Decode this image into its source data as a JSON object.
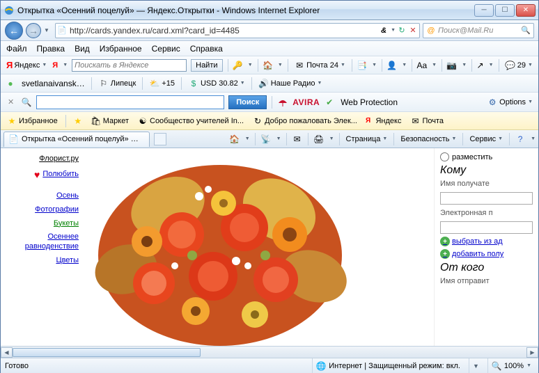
{
  "window": {
    "title": "Открытка «Осенний поцелуй» — Яндекс.Открытки - Windows Internet Explorer"
  },
  "nav": {
    "url": "http://cards.yandex.ru/card.xml?card_id=4485",
    "and": "&",
    "search_placeholder": "Поиск@Mail.Ru"
  },
  "menu": {
    "file": "Файл",
    "edit": "Правка",
    "view": "Вид",
    "fav": "Избранное",
    "tools": "Сервис",
    "help": "Справка"
  },
  "ytb": {
    "brand": "Яндекс",
    "placeholder": "Поискать в Яндексе",
    "find": "Найти",
    "mail": "Почта 24",
    "user": "svetlanaivansk…",
    "city": "Липецк",
    "temp": "+15",
    "usd": "USD 30.82",
    "radio": "Наше Радио",
    "count29": "29"
  },
  "avira": {
    "poisk": "Поиск",
    "brand": "AVIRA",
    "wp": "Web Protection",
    "opt": "Options"
  },
  "fav": {
    "label": "Избранное",
    "market": "Маркет",
    "teachers": "Сообщество учителей In...",
    "welcome": "Добро пожаловать  Элек...",
    "yandex": "Яндекс",
    "mail": "Почта"
  },
  "tab": {
    "title": "Открытка «Осенний поцелуй» — Янде..."
  },
  "cmd": {
    "page": "Страница",
    "safety": "Безопасность",
    "service": "Сервис"
  },
  "left": {
    "florist": "Флорист.ру",
    "like": "Полюбить",
    "autumn": "Осень",
    "photos": "Фотографии",
    "bouquets": "Букеты",
    "equinox1": "Осеннее",
    "equinox2": "равноденствие",
    "flowers": "Цветы"
  },
  "right": {
    "place": "разместить",
    "to": "Кому",
    "recip": "Имя получате",
    "email": "Электронная п",
    "addr": "выбрать из ад",
    "add": "добавить полу",
    "from": "От кого",
    "sender": "Имя отправит"
  },
  "status": {
    "ready": "Готово",
    "zone": "Интернет | Защищенный режим: вкл.",
    "zoom": "100%"
  }
}
